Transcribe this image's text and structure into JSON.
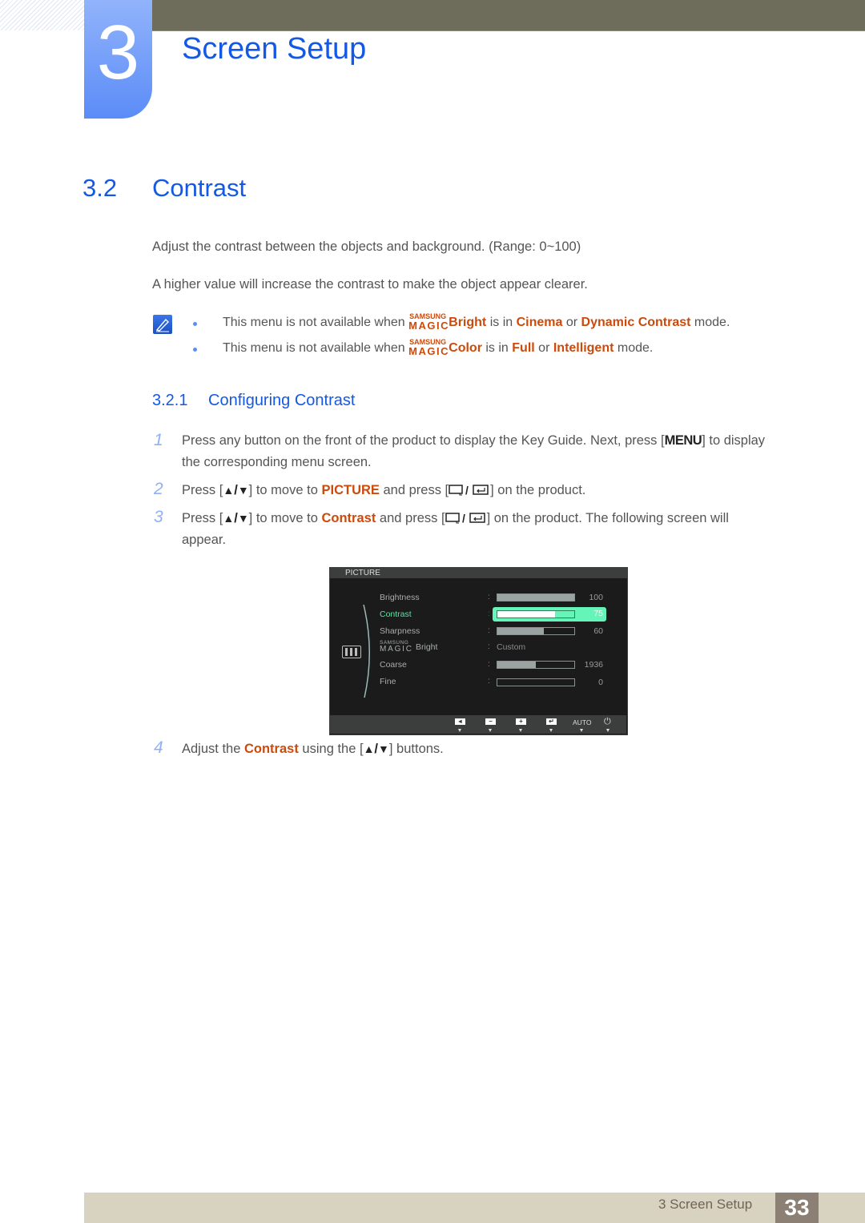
{
  "header": {
    "chapter_number": "3",
    "chapter_title": "Screen Setup"
  },
  "section": {
    "number": "3.2",
    "title": "Contrast",
    "paragraphs": [
      "Adjust the contrast between the objects and background. (Range: 0~100)",
      "A higher value will increase the contrast to make the object appear clearer."
    ]
  },
  "notes": [
    {
      "prefix": "This menu is not available when",
      "magic_small": "SAMSUNG",
      "magic_big": "MAGIC",
      "feature": "Bright",
      "mid1": "is in",
      "mode1": "Cinema",
      "or": "or",
      "mode2": "Dynamic Contrast",
      "suffix": "mode."
    },
    {
      "prefix": "This menu is not available when",
      "magic_small": "SAMSUNG",
      "magic_big": "MAGIC",
      "feature": "Color",
      "mid1": "is in",
      "mode1": "Full",
      "or": "or",
      "mode2": "Intelligent",
      "suffix": "mode."
    }
  ],
  "subsection": {
    "number": "3.2.1",
    "title": "Configuring Contrast"
  },
  "steps": [
    {
      "num": "1",
      "line1_a": "Press any button on the front of the product to display the Key Guide. Next, press [",
      "key": "MENU",
      "line1_b": "] to display",
      "line2": "the corresponding menu screen."
    },
    {
      "num": "2",
      "a": "Press [",
      "up": "▲",
      "slash": "/",
      "down": "▼",
      "b": "] to move to",
      "target": "PICTURE",
      "c": "and press [",
      "d": "] on the product."
    },
    {
      "num": "3",
      "a": "Press [",
      "up": "▲",
      "slash": "/",
      "down": "▼",
      "b": "] to move to",
      "target": "Contrast",
      "c": "and press [",
      "d": "] on the product. The following screen will",
      "line2": "appear."
    },
    {
      "num": "4",
      "a": "Adjust the",
      "target": "Contrast",
      "b": "using the [",
      "up": "▲",
      "slash": "/",
      "down": "▼",
      "c": "] buttons."
    }
  ],
  "osd": {
    "title": "PICTURE",
    "items": [
      {
        "label": "Brightness",
        "value": "100",
        "level": 100
      },
      {
        "label": "Contrast",
        "value": "75",
        "level": 75,
        "selected": true
      },
      {
        "label": "Sharpness",
        "value": "60",
        "level": 60
      },
      {
        "label_small": "SAMSUNG",
        "label_big": "MAGIC",
        "label": "Bright",
        "value": "Custom"
      },
      {
        "label": "Coarse",
        "value": "1936",
        "level": 50
      },
      {
        "label": "Fine",
        "value": "0",
        "level": 0
      }
    ],
    "footer_buttons": [
      "left-arrow-icon",
      "minus-icon",
      "plus-icon",
      "enter-icon",
      "AUTO",
      "power-icon"
    ],
    "auto_label": "AUTO",
    "colors": {
      "highlight": "#66f5b8",
      "active_text": "#5ee0a7"
    }
  },
  "footer": {
    "section_label": "3 Screen Setup",
    "page_number": "33"
  },
  "colors": {
    "heading_blue": "#1458e6",
    "highlight_orange": "#cc4a0b",
    "step_number_blue": "#8fb0f5"
  }
}
